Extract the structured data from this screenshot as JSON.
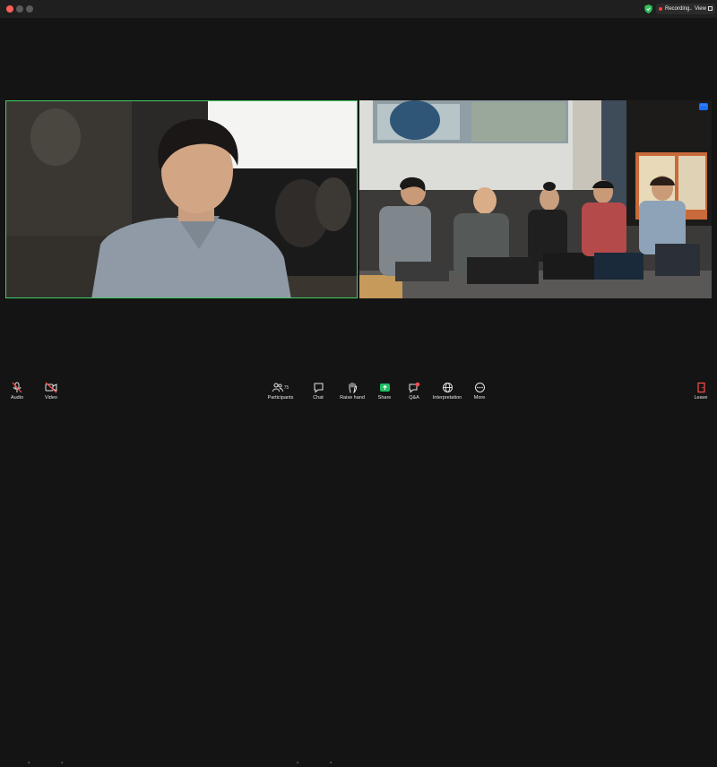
{
  "window": {
    "recording_label": "Recording...",
    "view_label": "View"
  },
  "colors": {
    "active_speaker_border": "#3fcf62",
    "recording_dot": "#ff4040",
    "share_green": "#1fbe63",
    "leave_red": "#ff4d4d"
  },
  "toolbar": {
    "audio": "Audio",
    "video": "Video",
    "participants": "Participants",
    "participants_count": "75",
    "chat": "Chat",
    "raise_hand": "Raise hand",
    "share": "Share",
    "qa": "Q&A",
    "interpretation": "Interpretation",
    "more": "More",
    "leave": "Leave"
  },
  "tiles": {
    "more_label": "···"
  }
}
